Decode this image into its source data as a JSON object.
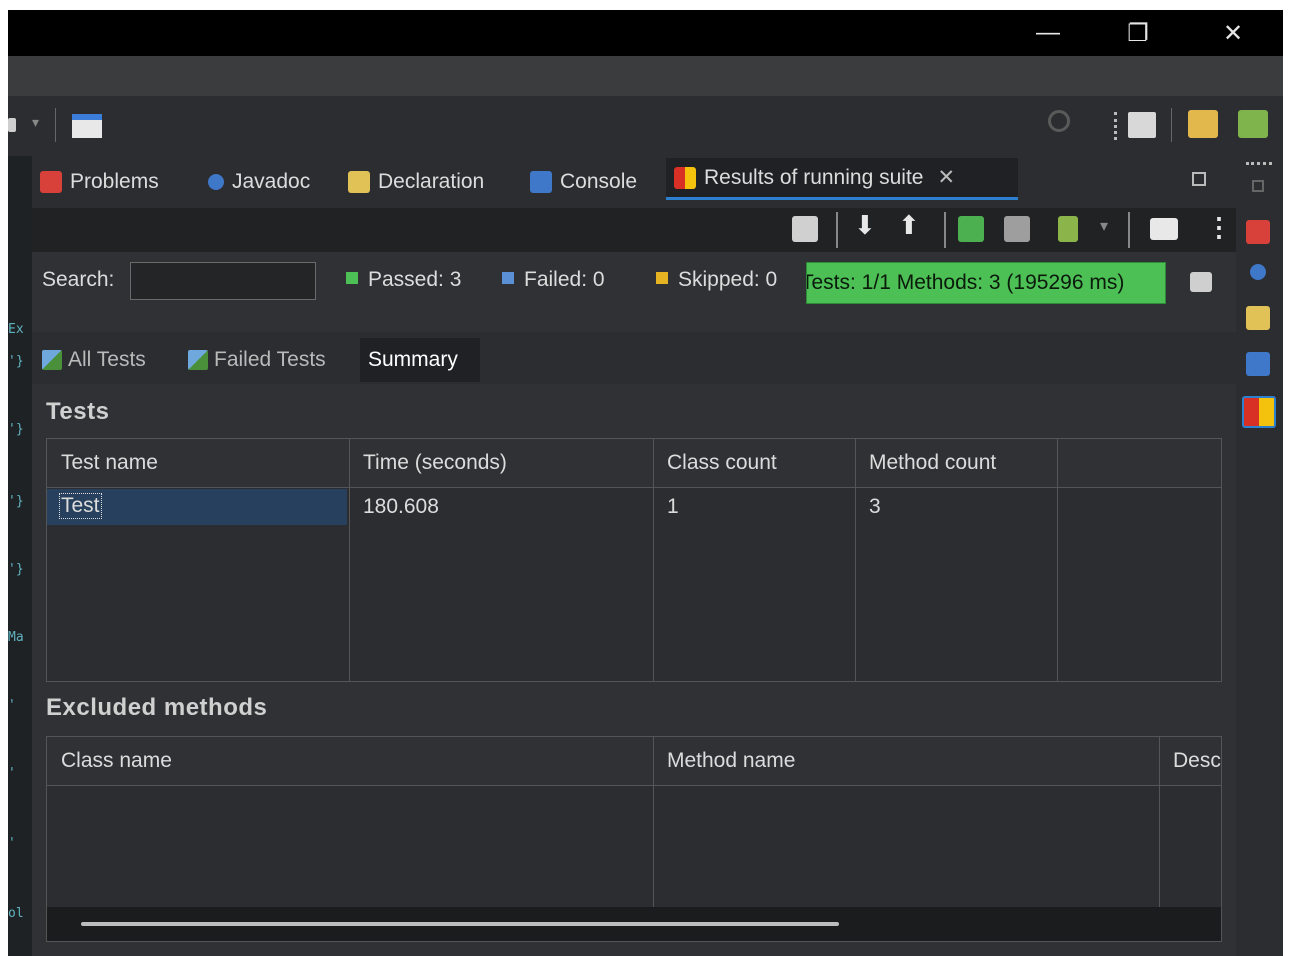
{
  "window": {
    "minimize": "—",
    "restore": "❐",
    "close": "✕"
  },
  "tabs": [
    {
      "label": "Problems"
    },
    {
      "label": "Javadoc"
    },
    {
      "label": "Declaration"
    },
    {
      "label": "Console"
    },
    {
      "label": "Results of running suite",
      "close": "✕"
    }
  ],
  "filter": {
    "search_label": "Search:",
    "search_value": "",
    "passed": "Passed: 3",
    "failed": "Failed: 0",
    "skipped": "Skipped: 0",
    "progress_text": "Tests: 1/1  Methods: 3 (195296 ms)",
    "progress_fraction": 1.0
  },
  "subtabs": [
    {
      "label": "All Tests"
    },
    {
      "label": "Failed Tests"
    },
    {
      "label": "Summary"
    }
  ],
  "summary": {
    "tests_title": "Tests",
    "tests_columns": [
      "Test name",
      "Time (seconds)",
      "Class count",
      "Method count",
      ""
    ],
    "tests_rows": [
      {
        "name": "Test",
        "time": "180.608",
        "classes": "1",
        "methods": "3"
      }
    ],
    "excluded_title": "Excluded methods",
    "excluded_columns": [
      "Class name",
      "Method name",
      "Desc"
    ]
  },
  "colors": {
    "accent": "#2d7fd0",
    "progress": "#4cbf55",
    "passed": "#4cbf55",
    "failed": "#5b8fd6",
    "skipped": "#e6b422"
  }
}
